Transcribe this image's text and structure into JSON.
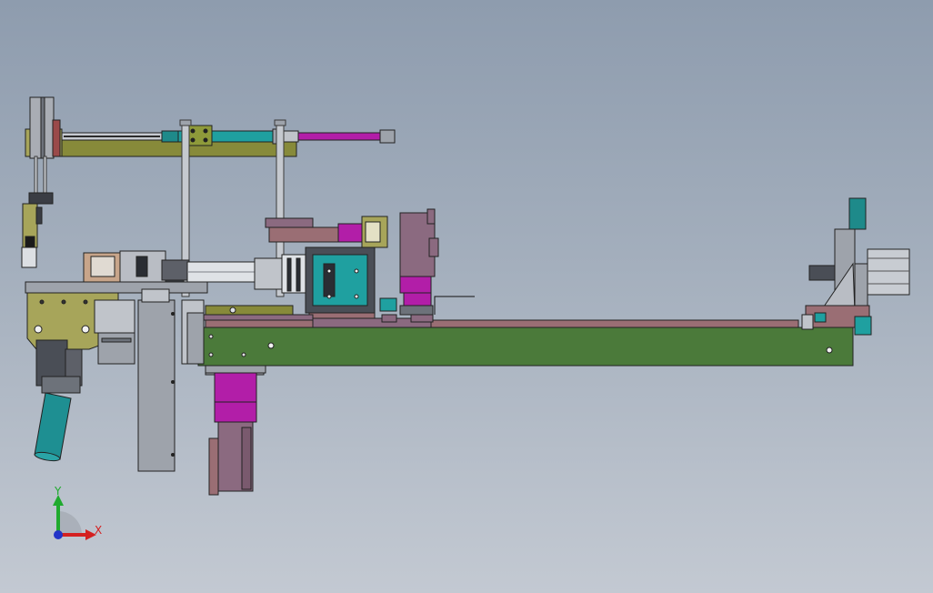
{
  "axes": {
    "y_label": "Y",
    "x_label": "X",
    "colors": {
      "y": "#1faa2e",
      "x": "#d42020",
      "origin": "#2333c8"
    }
  },
  "palette": {
    "frame_green": "#4b7a3a",
    "olive": "#878a3a",
    "olive_light": "#a7a55a",
    "magenta": "#b21ea8",
    "mauve": "#8b6a80",
    "cyan": "#1fa0a0",
    "teal": "#1e8a8a",
    "gray_steel": "#9aa0aa",
    "gray_dark": "#4a4e56",
    "rose": "#9a6e74"
  },
  "assemblies": [
    "top-linear-actuator",
    "vertical-guide-rods",
    "left-gripper-head",
    "tilted-teal-cylinder",
    "vertical-slide-column",
    "spindle-unit",
    "teal-slide-block",
    "magenta-motor-stack",
    "main-base-frame",
    "base-rail",
    "lower-magenta-motor",
    "right-end-cylinder"
  ]
}
